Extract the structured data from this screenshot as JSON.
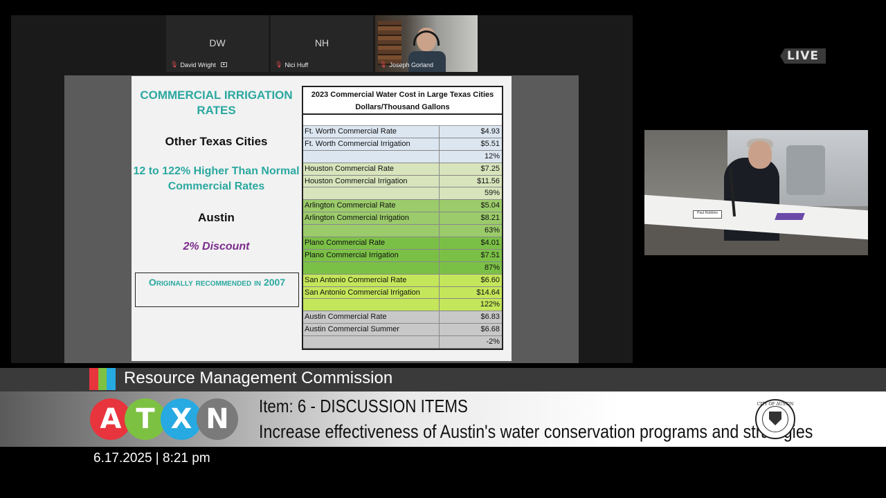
{
  "meeting": {
    "participants": [
      {
        "initials": "DW",
        "name": "David Wright",
        "video": false
      },
      {
        "initials": "NH",
        "name": "Nici Huff",
        "video": false
      },
      {
        "initials": "",
        "name": "Joseph Gorland",
        "video": true
      }
    ]
  },
  "slide": {
    "title": "COMMERCIAL IRRIGATION RATES",
    "other_cities": "Other Texas Cities",
    "higher_text": "12 to 122% Higher Than Normal Commercial Rates",
    "austin": "Austin",
    "discount": "2% Discount",
    "originally": "Originally recommended in 2007",
    "table_title_line1": "2023 Commercial Water Cost in Large Texas Cities",
    "table_title_line2": "Dollars/Thousand Gallons",
    "rows": [
      {
        "label": "Ft. Worth Commercial Rate",
        "value": "$4.93",
        "color": "#dce6f1"
      },
      {
        "label": "Ft. Worth Commercial Irrigation",
        "value": "$5.51",
        "color": "#dce6f1"
      },
      {
        "label": "",
        "value": "12%",
        "color": "#dce6f1"
      },
      {
        "label": "Houston Commercial Rate",
        "value": "$7.25",
        "color": "#d8e4bc"
      },
      {
        "label": "Houston Commercial Irrigation",
        "value": "$11.56",
        "color": "#d8e4bc"
      },
      {
        "label": "",
        "value": "59%",
        "color": "#d8e4bc"
      },
      {
        "label": "Arlington Commercial Rate",
        "value": "$5.04",
        "color": "#9bcb6a"
      },
      {
        "label": "Arlington Commercial Irrigation",
        "value": "$8.21",
        "color": "#9bcb6a"
      },
      {
        "label": "",
        "value": "63%",
        "color": "#9bcb6a"
      },
      {
        "label": "Plano Commercial Rate",
        "value": "$4.01",
        "color": "#7bc046"
      },
      {
        "label": "Plano Commercial Irrigation",
        "value": "$7.51",
        "color": "#7bc046"
      },
      {
        "label": "",
        "value": "87%",
        "color": "#7bc046"
      },
      {
        "label": "San Antonio Commercial Rate",
        "value": "$6.60",
        "color": "#c4e65a"
      },
      {
        "label": "San Antonio Commercial Irrigation",
        "value": "$14.64",
        "color": "#c4e65a"
      },
      {
        "label": "",
        "value": "122%",
        "color": "#c4e65a"
      },
      {
        "label": "Austin Commercial Rate",
        "value": "$6.83",
        "color": "#c8c8c8"
      },
      {
        "label": "Austin Commercial Summer",
        "value": "$6.68",
        "color": "#c8c8c8"
      },
      {
        "label": "",
        "value": "-2%",
        "color": "#c8c8c8"
      }
    ]
  },
  "broadcast": {
    "live_label": "LIVE",
    "commission": "Resource Management Commission",
    "logo_letters": [
      "A",
      "T",
      "X",
      "N"
    ],
    "logo_colors": [
      "#e8343d",
      "#7dc142",
      "#27a9e1",
      "#7a7a7a"
    ],
    "stripe_colors": [
      "#e8343d",
      "#7dc142",
      "#27a9e1"
    ],
    "item_title": "Item: 6 - DISCUSSION ITEMS",
    "item_description": "Increase effectiveness of Austin's water conservation programs and strategies",
    "seal_text": "CITY OF AUSTIN",
    "datetime": "6.17.2025 | 8:21 pm",
    "camera_nameplate": "Paul Robbins"
  }
}
